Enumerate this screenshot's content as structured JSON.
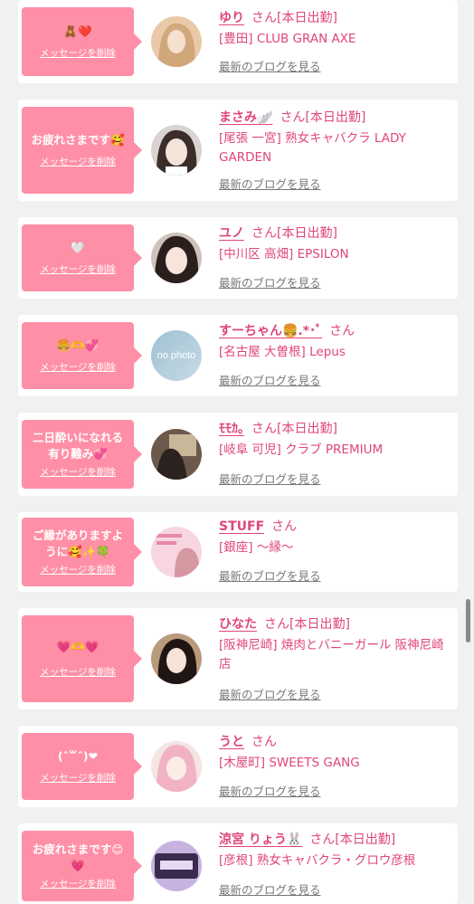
{
  "labels": {
    "delete": "メッセージを削除",
    "blog": "最新のブログを見る"
  },
  "colors": {
    "bubble": "#ff8fa6",
    "accent": "#e0457b",
    "link_gray": "#777777"
  },
  "cards": [
    {
      "message": "🧸❤️",
      "name": "ゆり",
      "status": "さん[本日出勤]",
      "shop": "[豊田] CLUB GRAN AXE",
      "avatar": "photo"
    },
    {
      "message": "お疲れさまです🥰",
      "name": "まさみ🪽",
      "status": "さん[本日出勤]",
      "shop": "[尾張 一宮] 熟女キャバクラ LADY GARDEN",
      "avatar": "photo"
    },
    {
      "message": "🤍",
      "name": "ユノ",
      "status": "さん[本日出勤]",
      "shop": "[中川区 高畑] EPSILON",
      "avatar": "photo"
    },
    {
      "message": "🍔🫶💞",
      "name": "すーちゃん🍔.*･ﾟ",
      "status": "さん",
      "shop": "[名古屋 大曽根] Lepus",
      "avatar": "no photo"
    },
    {
      "message": "二日酔いになれる\n有り難み💞",
      "name": "ﾓﾓｶ｡",
      "status": "さん[本日出勤]",
      "shop": "[岐阜 可児] クラブ PREMIUM",
      "avatar": "photo"
    },
    {
      "message": "ご縁がありますよ\nうに🥰✨🍀",
      "name": "STUFF",
      "status": "さん",
      "shop": "[銀座] 〜縁〜",
      "avatar": "photo"
    },
    {
      "message": "💗🫶💗",
      "name": "ひなた",
      "status": "さん[本日出勤]",
      "shop": "[阪神尼崎] 焼肉とバニーガール 阪神尼崎店",
      "avatar": "photo"
    },
    {
      "message": "(ˆ꒳ˆ)❤",
      "name": "うと",
      "status": "さん",
      "shop": "[木屋町] SWEETS GANG",
      "avatar": "photo"
    },
    {
      "message": "お疲れさまです😊\n💗",
      "name": "涼宮 りょう🐰",
      "status": "さん[本日出勤]",
      "shop": "[彦根] 熟女キャバクラ・グロウ彦根",
      "avatar": "photo"
    }
  ]
}
